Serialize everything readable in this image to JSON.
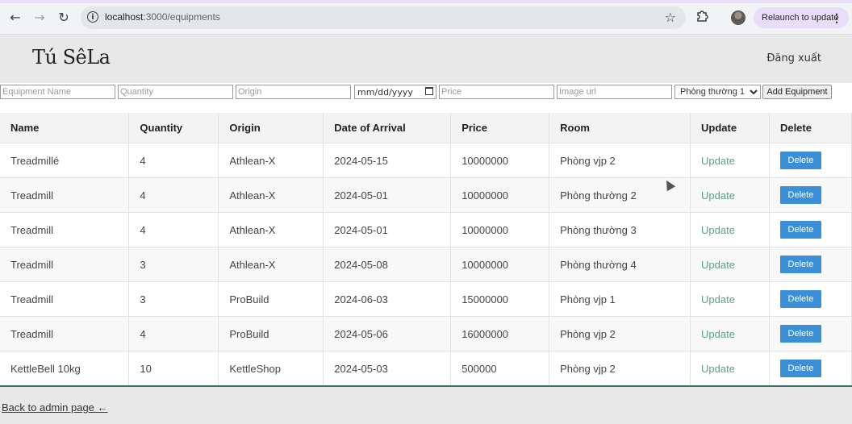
{
  "browser": {
    "url_host": "localhost",
    "url_path": ":3000/equipments",
    "relaunch_label": "Relaunch to update"
  },
  "header": {
    "logo": "Tú SêLa",
    "logout": "Đăng xuất"
  },
  "form": {
    "name_placeholder": "Equipment Name",
    "quantity_placeholder": "Quantity",
    "origin_placeholder": "Origin",
    "date_placeholder": "mm/dd/yyyy",
    "price_placeholder": "Price",
    "image_placeholder": "Image url",
    "room_selected": "Phòng thường 1",
    "add_label": "Add Equipment"
  },
  "table": {
    "headers": [
      "Name",
      "Quantity",
      "Origin",
      "Date of Arrival",
      "Price",
      "Room",
      "Update",
      "Delete"
    ],
    "rows": [
      [
        "Treadmillé",
        "4",
        "Athlean-X",
        "2024-05-15",
        "10000000",
        "Phòng vjp 2",
        "Update",
        "Delete"
      ],
      [
        "Treadmill",
        "4",
        "Athlean-X",
        "2024-05-01",
        "10000000",
        "Phòng thường 2",
        "Update",
        "Delete"
      ],
      [
        "Treadmill",
        "4",
        "Athlean-X",
        "2024-05-01",
        "10000000",
        "Phòng thường 3",
        "Update",
        "Delete"
      ],
      [
        "Treadmill",
        "3",
        "Athlean-X",
        "2024-05-08",
        "10000000",
        "Phòng thường 4",
        "Update",
        "Delete"
      ],
      [
        "Treadmill",
        "3",
        "ProBuild",
        "2024-06-03",
        "15000000",
        "Phòng vjp 1",
        "Update",
        "Delete"
      ],
      [
        "Treadmill",
        "4",
        "ProBuild",
        "2024-05-06",
        "16000000",
        "Phòng vjp 2",
        "Update",
        "Delete"
      ],
      [
        "KettleBell 10kg",
        "10",
        "KettleShop",
        "2024-05-03",
        "500000",
        "Phòng vjp 2",
        "Update",
        "Delete"
      ]
    ]
  },
  "footer": {
    "back_link": "Back to admin page ←"
  },
  "colors": {
    "update_link": "#5aa18a",
    "delete_button": "#3a8fd6",
    "relaunch_bg": "#e8def8"
  }
}
